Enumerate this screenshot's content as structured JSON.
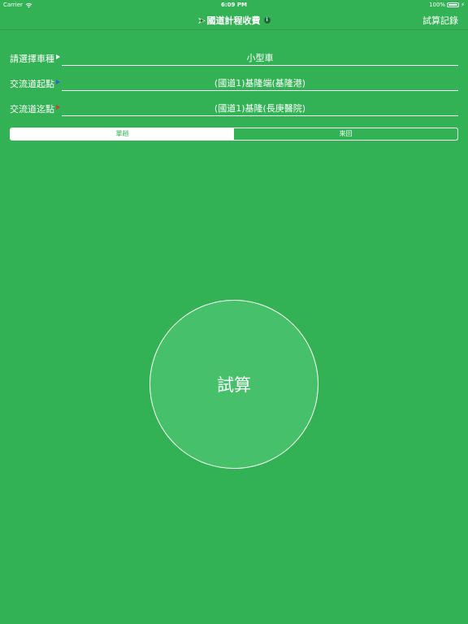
{
  "status_bar": {
    "carrier": "Carrier",
    "time": "6:09 PM",
    "battery": "100%"
  },
  "nav": {
    "title": "國道計程收費",
    "history_label": "試算記錄"
  },
  "form": {
    "vehicle": {
      "label": "請選擇車種",
      "value": "小型車"
    },
    "origin": {
      "label": "交流道起點",
      "value": "(國道1)基隆端(基隆港)"
    },
    "destination": {
      "label": "交流道迄點",
      "value": "(國道1)基隆(長庚醫院)"
    }
  },
  "trip_type": {
    "options": [
      "單趟",
      "來回"
    ],
    "selected": "單趟"
  },
  "calculate_label": "試算",
  "colors": {
    "background": "#33b155",
    "button": "#47c06a",
    "origin_marker": "#2f5fd6",
    "destination_marker": "#d23a2e"
  }
}
